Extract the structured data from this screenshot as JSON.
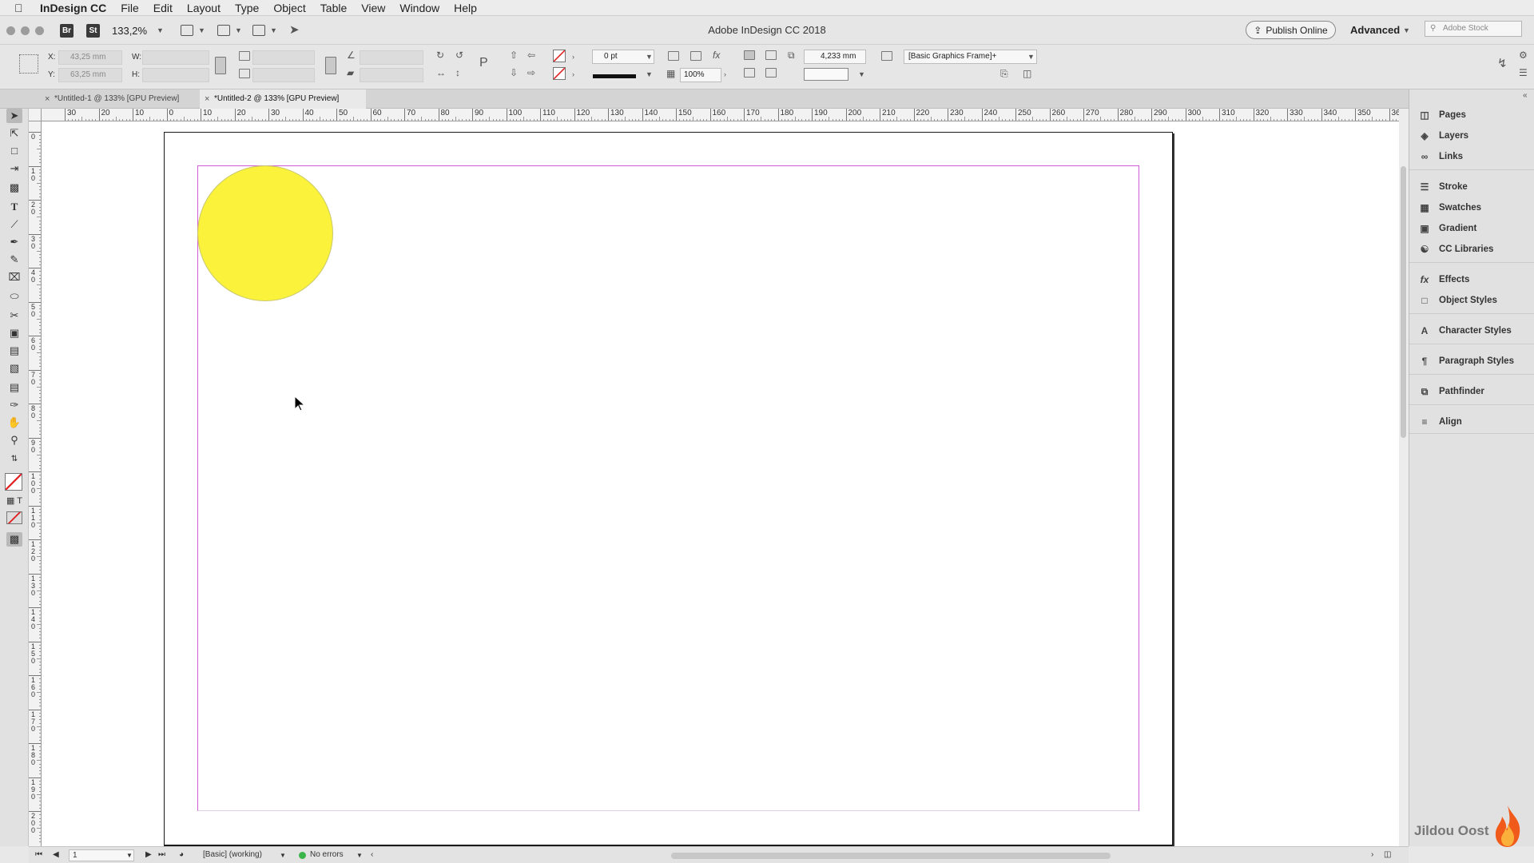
{
  "menubar": {
    "app_name": "InDesign CC",
    "items": [
      "File",
      "Edit",
      "Layout",
      "Type",
      "Object",
      "Table",
      "View",
      "Window",
      "Help"
    ]
  },
  "appbar": {
    "badge_bridge": "Br",
    "badge_stock": "St",
    "zoom": "133,2%",
    "window_title": "Adobe InDesign CC 2018",
    "publish_label": "Publish Online",
    "workspace": "Advanced",
    "stock_placeholder": "Adobe Stock"
  },
  "control": {
    "x_label": "X:",
    "y_label": "Y:",
    "w_label": "W:",
    "h_label": "H:",
    "x_value": "43,25 mm",
    "y_value": "63,25 mm",
    "stroke_weight": "0 pt",
    "opacity": "100%",
    "offset": "4,233 mm",
    "object_style": "[Basic Graphics Frame]+"
  },
  "tabs": [
    {
      "label": "*Untitled-1 @ 133% [GPU Preview]",
      "active": false
    },
    {
      "label": "*Untitled-2 @ 133% [GPU Preview]",
      "active": true
    }
  ],
  "ruler": {
    "h_ticks": [
      "30",
      "20",
      "10",
      "0",
      "10",
      "20",
      "30",
      "40",
      "50",
      "60",
      "70",
      "80",
      "90",
      "100",
      "110",
      "120",
      "130",
      "140",
      "150",
      "160",
      "170",
      "180",
      "190",
      "200",
      "210",
      "220",
      "230",
      "240",
      "250",
      "260",
      "270",
      "280",
      "290",
      "300",
      "310",
      "320",
      "330",
      "340",
      "350",
      "36"
    ],
    "v_ticks": [
      "0",
      "1 0",
      "2 0",
      "3 0",
      "4 0",
      "5 0",
      "6 0",
      "7 0",
      "8 0",
      "9 0",
      "1 0 0",
      "1 1 0",
      "1 2 0",
      "1 3 0",
      "1 4 0",
      "1 5 0",
      "1 6 0",
      "1 7 0",
      "1 8 0",
      "1 9 0",
      "2 0 0"
    ]
  },
  "panels": [
    {
      "label": "Pages",
      "icon": "pages-icon"
    },
    {
      "label": "Layers",
      "icon": "layers-icon"
    },
    {
      "label": "Links",
      "icon": "links-icon"
    },
    {
      "label": "Stroke",
      "icon": "stroke-icon"
    },
    {
      "label": "Swatches",
      "icon": "swatches-icon"
    },
    {
      "label": "Gradient",
      "icon": "gradient-icon"
    },
    {
      "label": "CC Libraries",
      "icon": "cc-libraries-icon"
    },
    {
      "label": "Effects",
      "icon": "effects-icon"
    },
    {
      "label": "Object Styles",
      "icon": "object-styles-icon"
    },
    {
      "label": "Character Styles",
      "icon": "character-styles-icon"
    },
    {
      "label": "Paragraph Styles",
      "icon": "paragraph-styles-icon"
    },
    {
      "label": "Pathfinder",
      "icon": "pathfinder-icon"
    },
    {
      "label": "Align",
      "icon": "align-icon"
    }
  ],
  "statusbar": {
    "page_number": "1",
    "profile": "[Basic] (working)",
    "preflight": "No errors"
  },
  "watermark": "Jildou Oost",
  "colors": {
    "circle_fill": "#fbf23c",
    "margin_guide": "#d35bd3",
    "preflight_ok": "#3bb54a"
  }
}
